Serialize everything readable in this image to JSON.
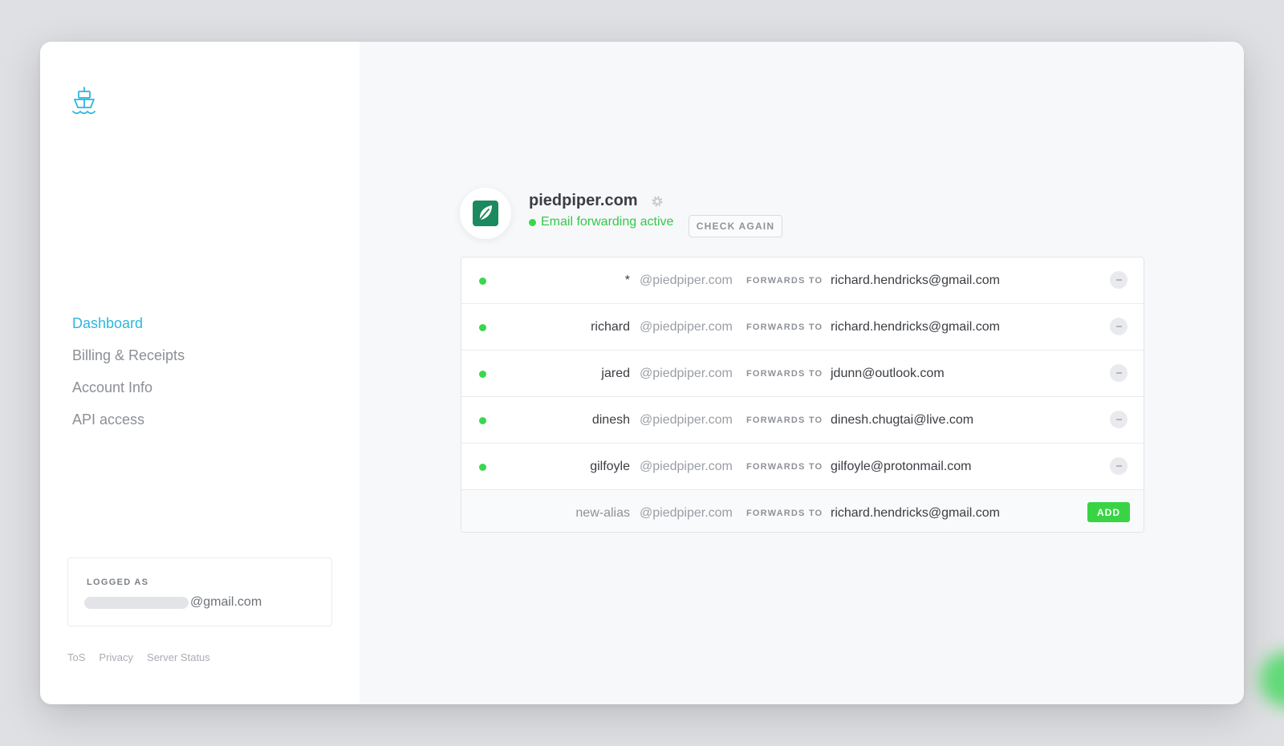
{
  "colors": {
    "accent": "#2bb8dc",
    "active_green": "#3ad64e",
    "add_button": "#39d445",
    "domain_logo_bg": "#1b8a5e"
  },
  "sidebar": {
    "logo_icon": "ship-icon",
    "nav": [
      {
        "label": "Dashboard",
        "active": true
      },
      {
        "label": "Billing & Receipts",
        "active": false
      },
      {
        "label": "Account Info",
        "active": false
      },
      {
        "label": "API access",
        "active": false
      }
    ],
    "login": {
      "label": "LOGGED AS",
      "email_domain": "@gmail.com"
    },
    "footer_links": [
      "ToS",
      "Privacy",
      "Server Status"
    ]
  },
  "domain": {
    "name": "piedpiper.com",
    "logo_icon": "leaf-icon",
    "settings_icon": "gear-icon",
    "status": "Email forwarding active",
    "check_again_label": "CHECK AGAIN"
  },
  "aliases": {
    "domain_suffix": "@piedpiper.com",
    "forwards_to_label": "FORWARDS TO",
    "rows": [
      {
        "alias": "*",
        "target": "richard.hendricks@gmail.com",
        "active": true
      },
      {
        "alias": "richard",
        "target": "richard.hendricks@gmail.com",
        "active": true
      },
      {
        "alias": "jared",
        "target": "jdunn@outlook.com",
        "active": true
      },
      {
        "alias": "dinesh",
        "target": "dinesh.chugtai@live.com",
        "active": true
      },
      {
        "alias": "gilfoyle",
        "target": "gilfoyle@protonmail.com",
        "active": true
      }
    ],
    "new_row": {
      "alias_placeholder": "new-alias",
      "target": "richard.hendricks@gmail.com",
      "add_label": "ADD"
    }
  }
}
